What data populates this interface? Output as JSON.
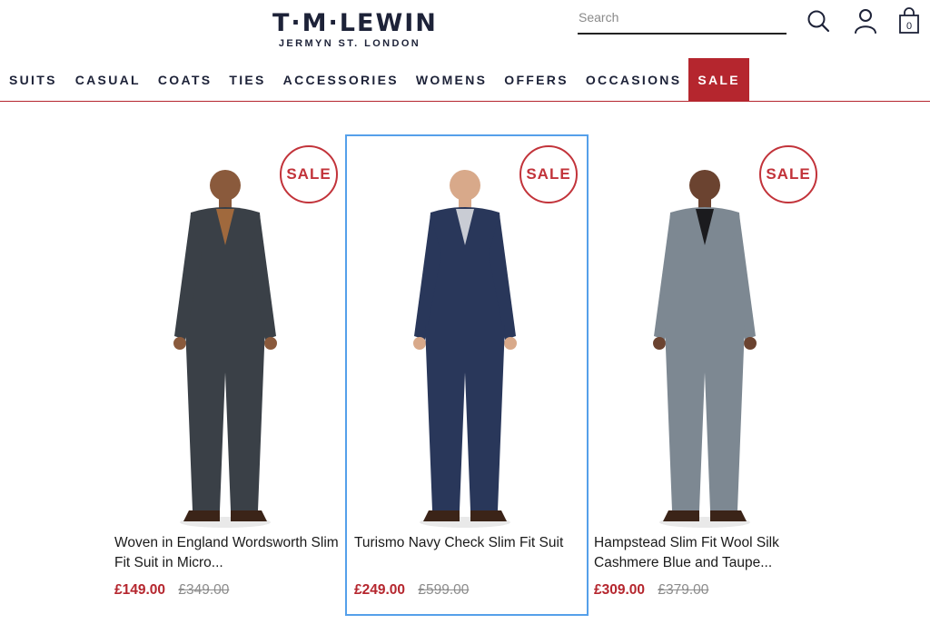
{
  "header": {
    "logo_main": "T·M·LEWIN",
    "logo_sub": "JERMYN ST. LONDON",
    "search_placeholder": "Search",
    "icons": [
      "search-icon",
      "account-icon",
      "bag-icon"
    ],
    "bag_count": "0"
  },
  "nav": {
    "items": [
      "SUITS",
      "CASUAL",
      "COATS",
      "TIES",
      "ACCESSORIES",
      "WOMENS",
      "OFFERS",
      "OCCASIONS",
      "SALE"
    ]
  },
  "products": [
    {
      "badge": "SALE",
      "name": "Woven in England Wordsworth Slim Fit Suit in Micro...",
      "price_now": "£149.00",
      "price_was": "£349.00",
      "suit_color": "#3a4047",
      "selected": false
    },
    {
      "badge": "SALE",
      "name": "Turismo Navy Check Slim Fit Suit",
      "price_now": "£249.00",
      "price_was": "£599.00",
      "suit_color": "#29375a",
      "selected": true
    },
    {
      "badge": "SALE",
      "name": "Hampstead Slim Fit Wool Silk Cashmere Blue and Taupe...",
      "price_now": "£309.00",
      "price_was": "£379.00",
      "suit_color": "#7d8892",
      "selected": false
    }
  ],
  "colors": {
    "brand_navy": "#1d2238",
    "sale_red": "#b5262e",
    "selection_blue": "#55a0ea",
    "struck_price": "#8c8c8c"
  }
}
